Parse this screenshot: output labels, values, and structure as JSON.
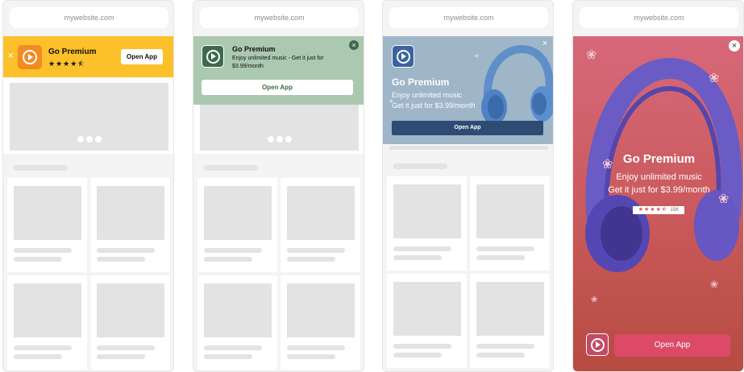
{
  "url": "mywebsite.com",
  "colors": {
    "banner1_bg": "#fcc02b",
    "banner1_icon": "#f28b23",
    "banner2_bg": "#abc8b1",
    "banner2_icon": "#3f6a4c",
    "banner3_bg": "#9fb5c8",
    "banner3_btn": "#2e4c73",
    "ad4_btn": "#dc4a68"
  },
  "ads": {
    "banner1": {
      "title": "Go Premium",
      "rating_stars": "★★★★⯪",
      "button": "Open App",
      "close": "×"
    },
    "banner2": {
      "title": "Go Premium",
      "line1": "Enjoy unlimited music - Get it just for",
      "line2": "$3.99/month",
      "button": "Open App",
      "close": "×"
    },
    "banner3": {
      "title": "Go Premium",
      "line1": "Enjoy unlimited music",
      "line2": "Get it just for $3.99/month",
      "button": "Open App",
      "close": "×"
    },
    "interstitial": {
      "title": "Go Premium",
      "line1": "Enjoy unlimited music",
      "line2": "Get it just for $3.99/month",
      "rating_stars": "★★★★⯪",
      "rating_count": "15K",
      "button": "Open App",
      "close": "×"
    }
  }
}
